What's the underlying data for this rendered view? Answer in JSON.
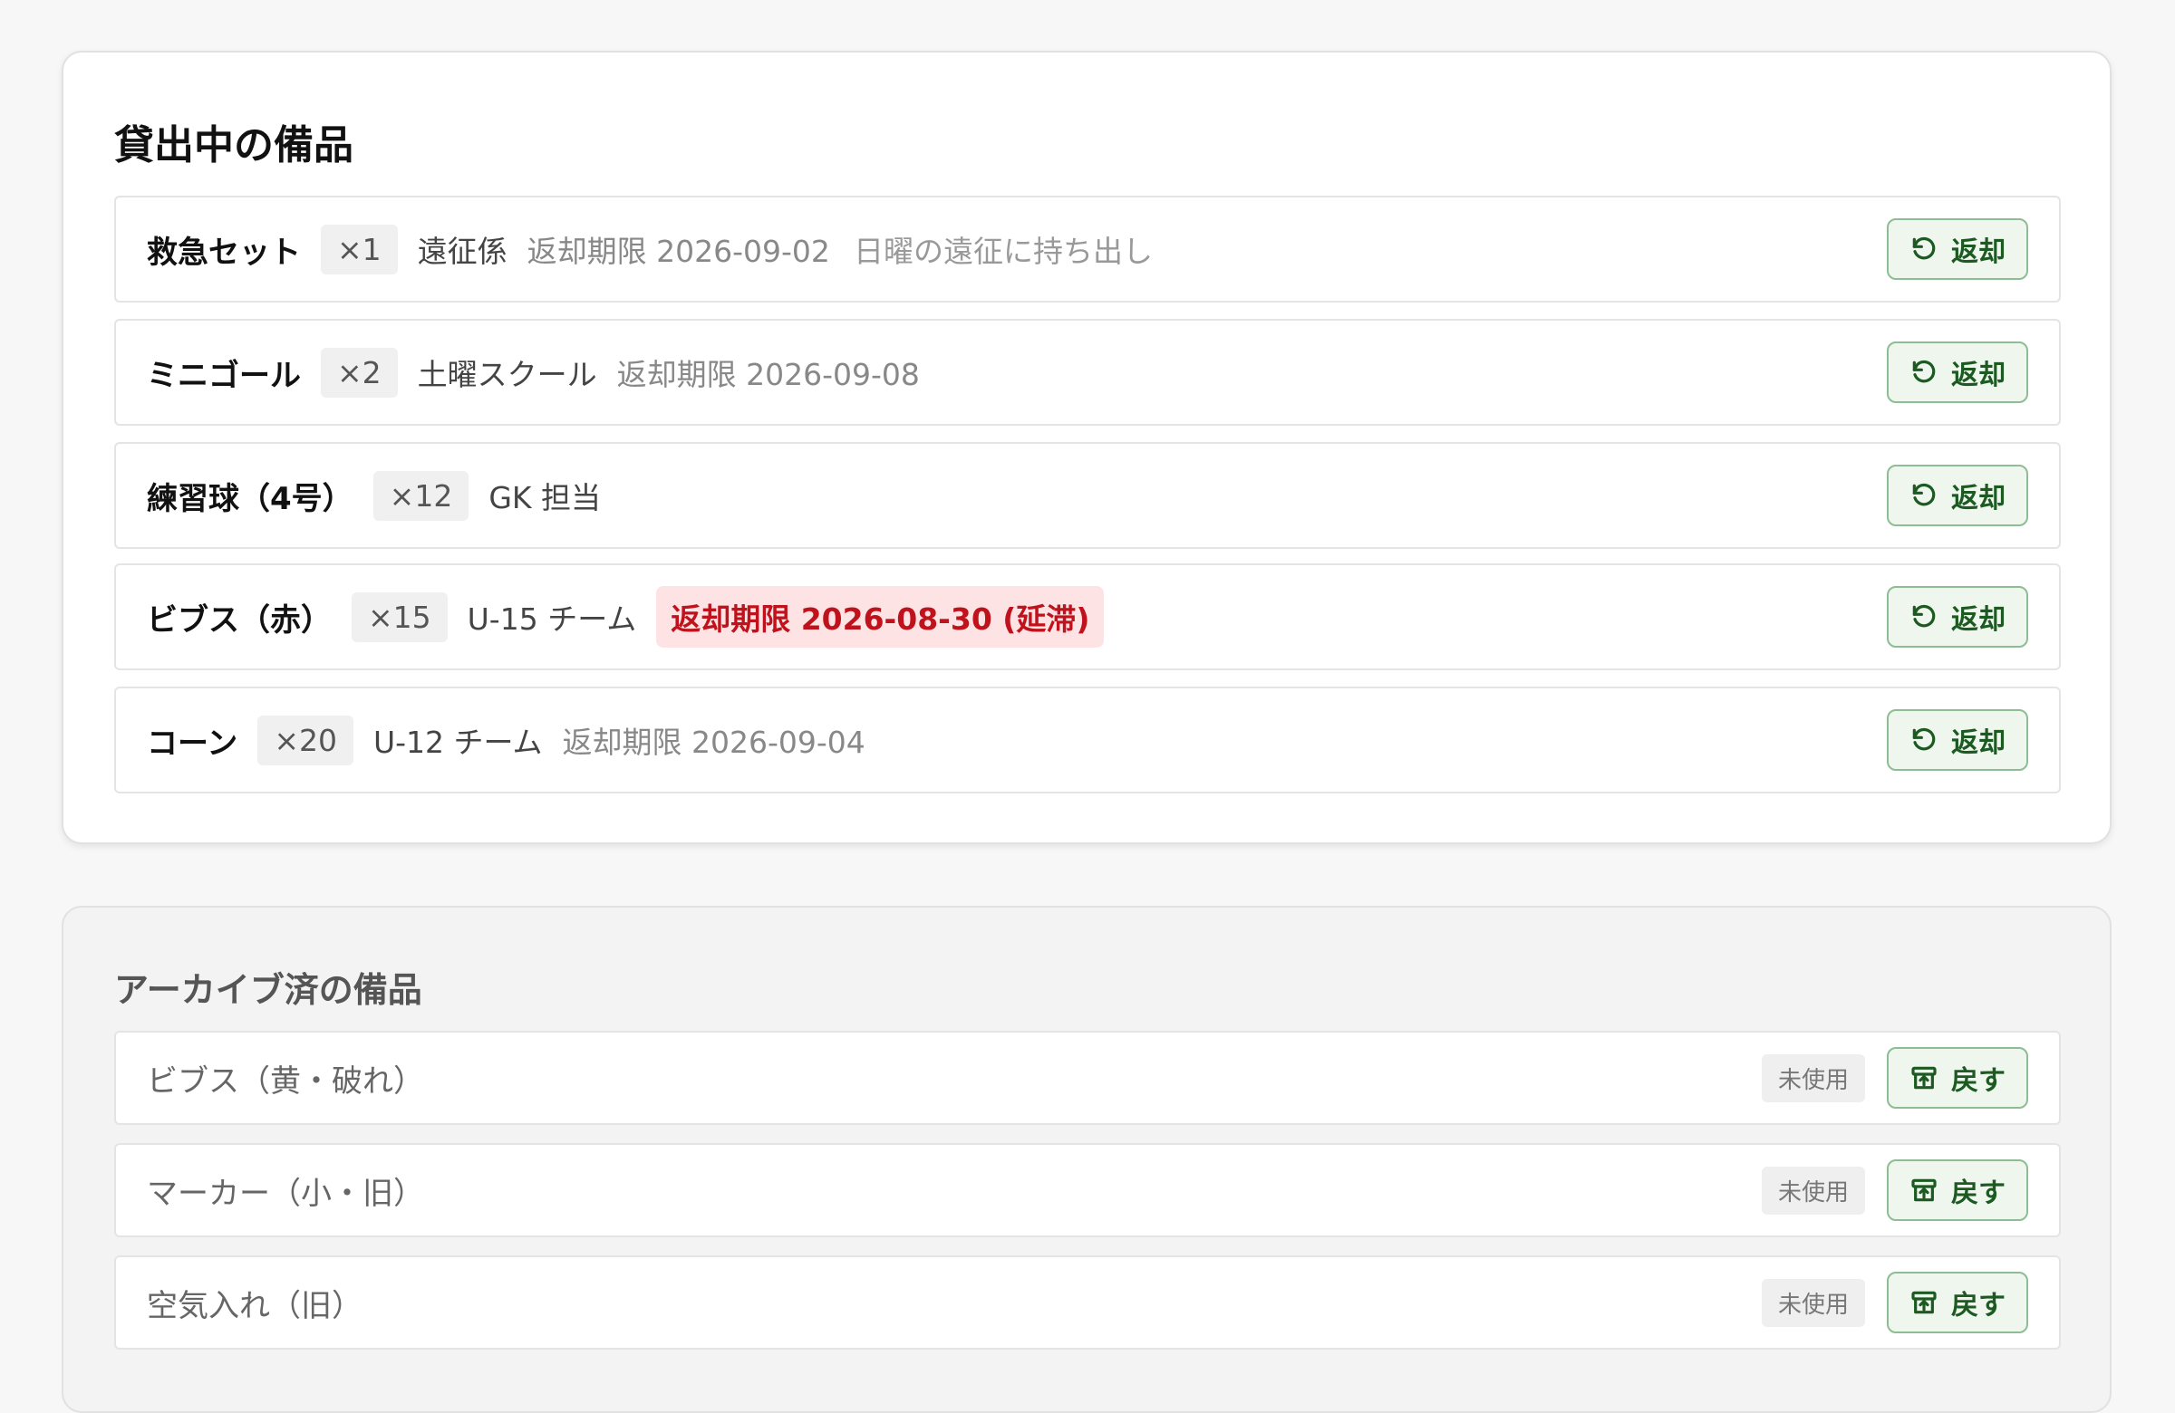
{
  "active_section": {
    "title": "貸出中の備品",
    "return_label": "返却",
    "items": [
      {
        "name": "救急セット",
        "qty": "×1",
        "holder": "遠征係",
        "due": "返却期限 2026-09-02",
        "note": "日曜の遠征に持ち出し"
      },
      {
        "name": "ミニゴール",
        "qty": "×2",
        "holder": "土曜スクール",
        "due": "返却期限 2026-09-08",
        "note": ""
      },
      {
        "name": "練習球（4号）",
        "qty": "×12",
        "holder": "GK 担当",
        "due": "",
        "note": ""
      },
      {
        "name": "ビブス（赤）",
        "qty": "×15",
        "holder": "U-15 チーム",
        "due": "返却期限 2026-08-30 (延滞)",
        "note": ""
      },
      {
        "name": "コーン",
        "qty": "×20",
        "holder": "U-12 チーム",
        "due": "返却期限 2026-09-04",
        "note": ""
      }
    ]
  },
  "archived_section": {
    "title": "アーカイブ済の備品",
    "restore_label": "戻す",
    "status_label": "未使用",
    "items": [
      {
        "name": "ビブス（黄・破れ）"
      },
      {
        "name": "マーカー（小・旧）"
      },
      {
        "name": "空気入れ（旧）"
      }
    ]
  },
  "colors": {
    "accent_green": "#1c5a22",
    "overdue_red": "#c0121c",
    "overdue_bg": "#fde3e3"
  },
  "icons": {
    "return": "undo-arrow-icon",
    "restore": "unarchive-icon"
  }
}
